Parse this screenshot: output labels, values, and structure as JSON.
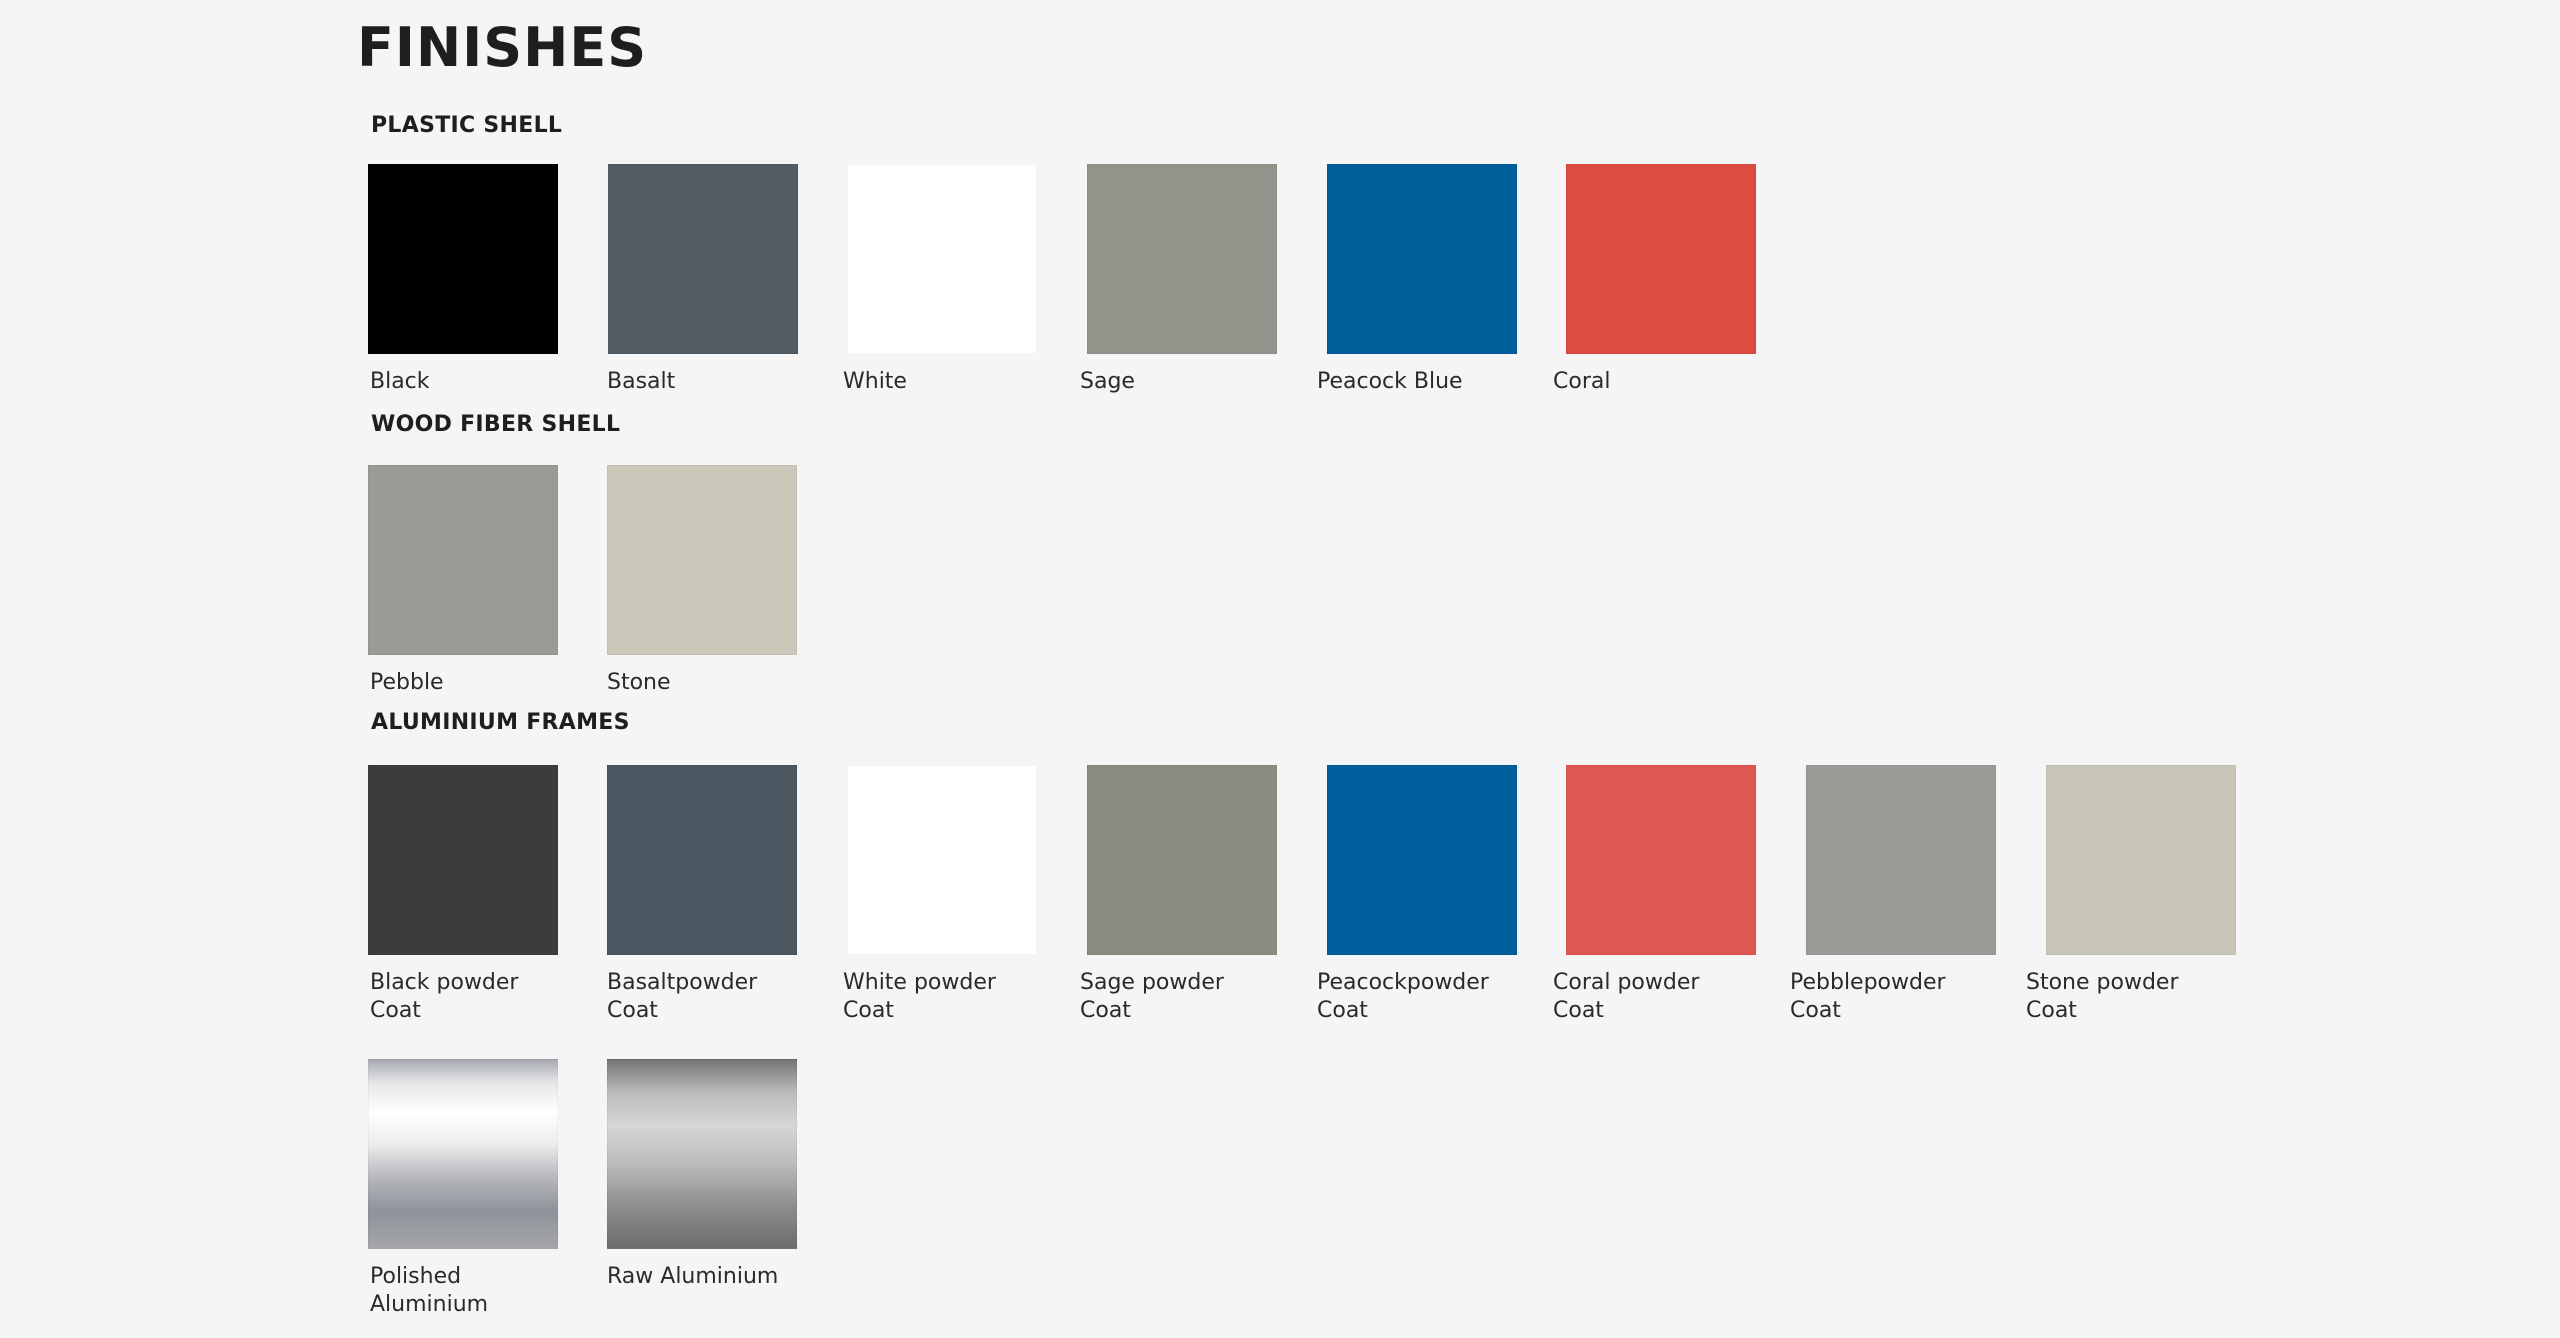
{
  "page": {
    "title": "FINISHES",
    "background": "#f5f5f5"
  },
  "sections": [
    {
      "title": "PLASTIC SHELL",
      "items": [
        {
          "label": "Black",
          "color": "#000000"
        },
        {
          "label": "Basalt",
          "color": "#535c63"
        },
        {
          "label": "White",
          "color": "#ffffff"
        },
        {
          "label": "Sage",
          "color": "#93938b"
        },
        {
          "label": "Peacock Blue",
          "color": "#005e9b"
        },
        {
          "label": "Coral",
          "color": "#dc4c43"
        }
      ]
    },
    {
      "title": "WOOD FIBER SHELL",
      "items": [
        {
          "label": "Pebble",
          "color": "#9b9a96"
        },
        {
          "label": "Stone",
          "color": "#c9c8b9"
        }
      ]
    },
    {
      "title": "ALUMINIUM FRAMES",
      "items": [
        {
          "label": "Black powder Coat",
          "color": "#3c3c3c"
        },
        {
          "label": "Basaltpowder Coat",
          "color": "#4b5861"
        },
        {
          "label": "White powder Coat",
          "color": "#ffffff"
        },
        {
          "label": "Sage powder Coat",
          "color": "#8c8b80"
        },
        {
          "label": "Peacockpowder Coat",
          "color": "#005f9c"
        },
        {
          "label": "Coral powder Coat",
          "color": "#de5752"
        },
        {
          "label": "Pebblepowder Coat",
          "color": "#9b9a96"
        },
        {
          "label": "Stone powder Coat",
          "color": "#c8c6b7"
        },
        {
          "label": "Polished Aluminium",
          "color": "#c8c8cc"
        },
        {
          "label": "Raw Aluminium",
          "color": "#a6a6a6"
        }
      ]
    }
  ]
}
